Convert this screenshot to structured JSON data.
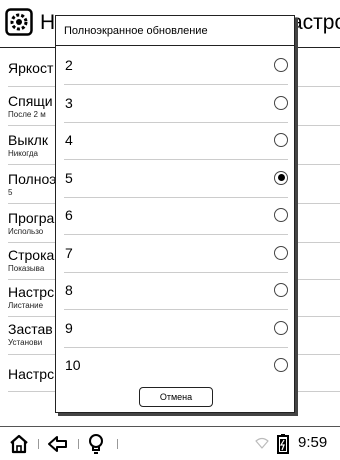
{
  "header": {
    "title_left": "Н",
    "title_right": "астро.."
  },
  "settings": {
    "rows": [
      {
        "label": "Яркост",
        "sub": ""
      },
      {
        "label": "Спящи",
        "sub": "После 2 м"
      },
      {
        "label": "Выклк",
        "sub": "Никогда"
      },
      {
        "label": "Полноэ",
        "sub": "5"
      },
      {
        "label": "Програ",
        "sub": "Использо"
      },
      {
        "label": "Строка",
        "sub": "Показыва"
      },
      {
        "label": "Настрс",
        "sub": "Листание"
      },
      {
        "label": "Застав",
        "sub": "Установи"
      },
      {
        "label": "Настрс",
        "sub": ""
      }
    ]
  },
  "dialog": {
    "title": "Полноэкранное обновление",
    "options": [
      {
        "label": "2",
        "selected": false
      },
      {
        "label": "3",
        "selected": false
      },
      {
        "label": "4",
        "selected": false
      },
      {
        "label": "5",
        "selected": true
      },
      {
        "label": "6",
        "selected": false
      },
      {
        "label": "7",
        "selected": false
      },
      {
        "label": "8",
        "selected": false
      },
      {
        "label": "9",
        "selected": false
      },
      {
        "label": "10",
        "selected": false
      }
    ],
    "cancel_label": "Отмена"
  },
  "statusbar": {
    "time": "9:59",
    "icons": [
      "home-icon",
      "back-icon",
      "bulb-icon",
      "wifi-icon",
      "battery-icon"
    ]
  }
}
